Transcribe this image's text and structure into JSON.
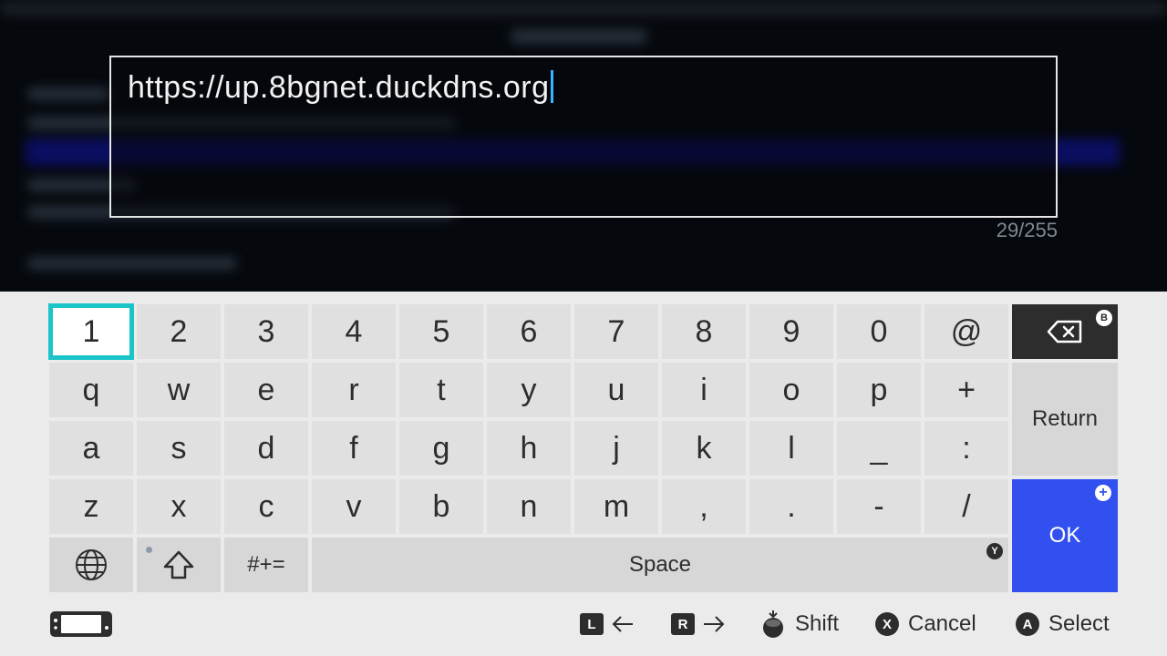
{
  "text_field": {
    "value": "https://up.8bgnet.duckdns.org",
    "char_count": "29/255"
  },
  "keyboard": {
    "rows": [
      [
        "1",
        "2",
        "3",
        "4",
        "5",
        "6",
        "7",
        "8",
        "9",
        "0",
        "@"
      ],
      [
        "q",
        "w",
        "e",
        "r",
        "t",
        "y",
        "u",
        "i",
        "o",
        "p",
        "+"
      ],
      [
        "a",
        "s",
        "d",
        "f",
        "g",
        "h",
        "j",
        "k",
        "l",
        "_",
        ":"
      ],
      [
        "z",
        "x",
        "c",
        "v",
        "b",
        "n",
        "m",
        ",",
        ".",
        "-",
        "/"
      ]
    ],
    "selected_key": "1",
    "symbols_label": "#+=",
    "space_label": "Space",
    "return_label": "Return",
    "ok_label": "OK",
    "backspace_button": "B",
    "space_button": "Y",
    "ok_button": "+"
  },
  "footer": {
    "left_button": "L",
    "right_button": "R",
    "shift_label": "Shift",
    "cancel_button": "X",
    "cancel_label": "Cancel",
    "select_button": "A",
    "select_label": "Select"
  },
  "colors": {
    "accent_selected": "#1bc4c9",
    "ok_blue": "#3250f0",
    "caret": "#33b5ff"
  },
  "icons": {
    "backspace": "backspace-icon",
    "globe": "globe-icon",
    "shift": "shift-arrow-icon",
    "handheld": "handheld-console-icon",
    "stick": "stick-press-icon"
  }
}
